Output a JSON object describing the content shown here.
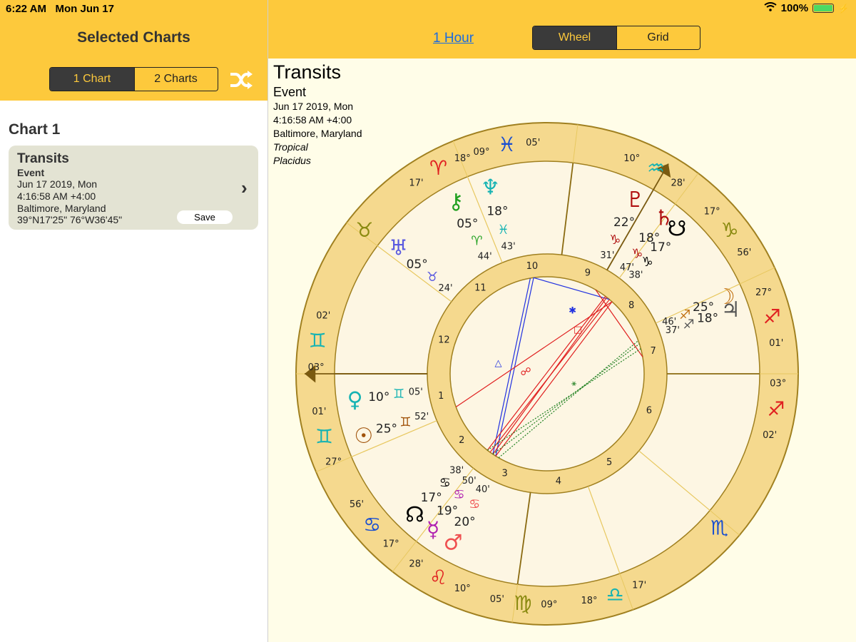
{
  "status": {
    "time": "6:22 AM",
    "date": "Mon Jun 17",
    "battery": "100%",
    "battery_level": 1.0
  },
  "left": {
    "title": "Selected Charts",
    "segments": [
      "1 Chart",
      "2 Charts"
    ],
    "selected_segment": "1 Chart",
    "chart_heading": "Chart 1",
    "card": {
      "title": "Transits",
      "type": "Event",
      "date": "Jun 17 2019, Mon",
      "time": "4:16:58 AM +4:00",
      "place": "Baltimore, Maryland",
      "coords": "39°N17'25\" 76°W36'45\"",
      "save": "Save"
    }
  },
  "toolbar": {
    "hour_link": "1 Hour",
    "view_tabs": [
      "Wheel",
      "Grid"
    ],
    "selected_view": "Wheel"
  },
  "chart_info": {
    "title": "Transits",
    "type": "Event",
    "date": "Jun 17 2019, Mon",
    "time": "4:16:58 AM +4:00",
    "place": "Baltimore, Maryland",
    "zodiac": "Tropical",
    "houses": "Placidus"
  },
  "wheel": {
    "colors": {
      "ring": "#f5d98e",
      "ring_border": "#a08020",
      "background": "#fdf6e3",
      "aspect_red": "#e02020",
      "aspect_blue": "#2030e0",
      "aspect_green": "#208020"
    },
    "house_numbers": [
      "1",
      "2",
      "3",
      "4",
      "5",
      "6",
      "7",
      "8",
      "9",
      "10",
      "11",
      "12"
    ],
    "cusp_labels": [
      {
        "deg": "09°",
        "sign": "♓",
        "min": "05'",
        "sign_color": "#1a4fd0"
      },
      {
        "deg": "10°",
        "sign": "♒",
        "min": "28'",
        "sign_color": "#16b3b3"
      },
      {
        "deg": "17°",
        "sign": "♑",
        "min": "56'",
        "sign_color": "#8a8a10"
      },
      {
        "deg": "27°",
        "sign": "♐",
        "min": "01'",
        "sign_color": "#e02020"
      },
      {
        "deg": "03°",
        "sign": "♐",
        "min": "02'",
        "sign_color": "#e02020"
      },
      {
        "deg": "",
        "sign": "♏",
        "min": "",
        "sign_color": "#1a4fd0"
      },
      {
        "deg": "17'",
        "sign": "♎",
        "min": "18°",
        "sign_color": "#16b3b3"
      },
      {
        "deg": "09°",
        "sign": "♍",
        "min": "05'",
        "sign_color": "#8a8a10"
      },
      {
        "deg": "10°",
        "sign": "♌",
        "min": "28'",
        "sign_color": "#e02020"
      },
      {
        "deg": "17°",
        "sign": "♋",
        "min": "56'",
        "sign_color": "#1a4fd0"
      },
      {
        "deg": "27°",
        "sign": "♊",
        "min": "01'",
        "sign_color": "#16b3b3"
      },
      {
        "deg": "03°",
        "sign": "♊",
        "min": "02'",
        "sign_color": "#16b3b3"
      },
      {
        "deg": "",
        "sign": "♉",
        "min": "",
        "sign_color": "#8a8a10"
      },
      {
        "deg": "17'",
        "sign": "♈",
        "min": "18°",
        "sign_color": "#e02020"
      }
    ],
    "planets": [
      {
        "glyph": "♆",
        "deg": "18°",
        "sign": "♓",
        "min": "43'",
        "color": "#16b3b3"
      },
      {
        "glyph": "⚷",
        "deg": "05°",
        "sign": "♈",
        "min": "44'",
        "color": "#20a020"
      },
      {
        "glyph": "♅",
        "deg": "05°",
        "sign": "♉",
        "min": "24'",
        "color": "#5a5ae0"
      },
      {
        "glyph": "♀",
        "deg": "10°",
        "sign": "♊",
        "min": "05'",
        "color": "#16b3b3"
      },
      {
        "glyph": "☉",
        "deg": "25°",
        "sign": "♊",
        "min": "52'",
        "color": "#a0520a"
      },
      {
        "glyph": "☊",
        "deg": "17°",
        "sign": "♋",
        "min": "38'",
        "color": "#000000"
      },
      {
        "glyph": "☿",
        "deg": "19°",
        "sign": "♋",
        "min": "50'",
        "color": "#b020b0"
      },
      {
        "glyph": "♂",
        "deg": "20°",
        "sign": "♋",
        "min": "40'",
        "color": "#ef5050"
      },
      {
        "glyph": "♇",
        "deg": "22°",
        "sign": "♑",
        "min": "31'",
        "color": "#b01010"
      },
      {
        "glyph": "♄",
        "deg": "18°",
        "sign": "♑",
        "min": "47'",
        "color": "#b01010"
      },
      {
        "glyph": "☋",
        "deg": "17°",
        "sign": "♑",
        "min": "38'",
        "color": "#000000"
      },
      {
        "glyph": "☽",
        "deg": "25°",
        "sign": "♐",
        "min": "46'",
        "color": "#c07010"
      },
      {
        "glyph": "♃",
        "deg": "18°",
        "sign": "♐",
        "min": "37'",
        "color": "#555555"
      }
    ]
  }
}
